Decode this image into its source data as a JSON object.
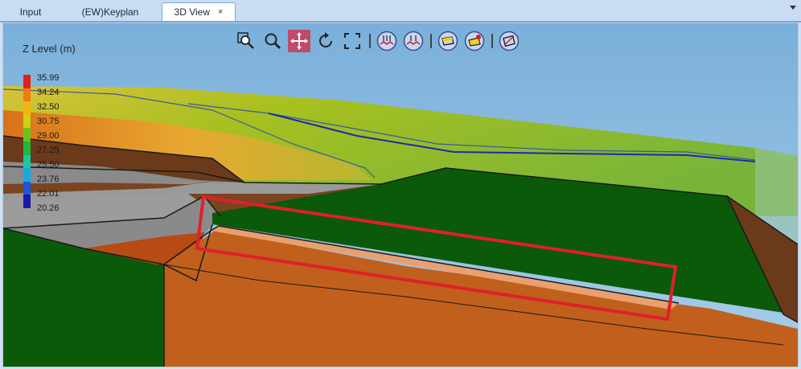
{
  "tabs": [
    {
      "label": "Input"
    },
    {
      "label": "(EW)Keyplan"
    },
    {
      "label": "3D View",
      "close": "×"
    }
  ],
  "toolbar": {
    "buttons": [
      "zoom-extents-icon",
      "zoom-icon",
      "pan-icon",
      "rotate-icon",
      "fit-view-icon",
      "surface-contour-icon",
      "surface-contour-alt-icon",
      "layer-frame-icon",
      "layer-fill-icon",
      "section-view-icon"
    ],
    "active": "pan-icon"
  },
  "legend": {
    "title": "Z Level (m)",
    "values": [
      "35.99",
      "34.24",
      "32.50",
      "30.75",
      "29.00",
      "27.25",
      "25.50",
      "23.76",
      "22.01",
      "20.26"
    ],
    "colors": [
      "#e0201c",
      "#f07a12",
      "#f0b410",
      "#c8d414",
      "#6cc21c",
      "#1cb838",
      "#18c8a0",
      "#1ca8e0",
      "#1c58d8",
      "#1a1aa8"
    ]
  },
  "colors": {
    "highlight": "#e0202a",
    "accent": "#7aa6dd"
  }
}
